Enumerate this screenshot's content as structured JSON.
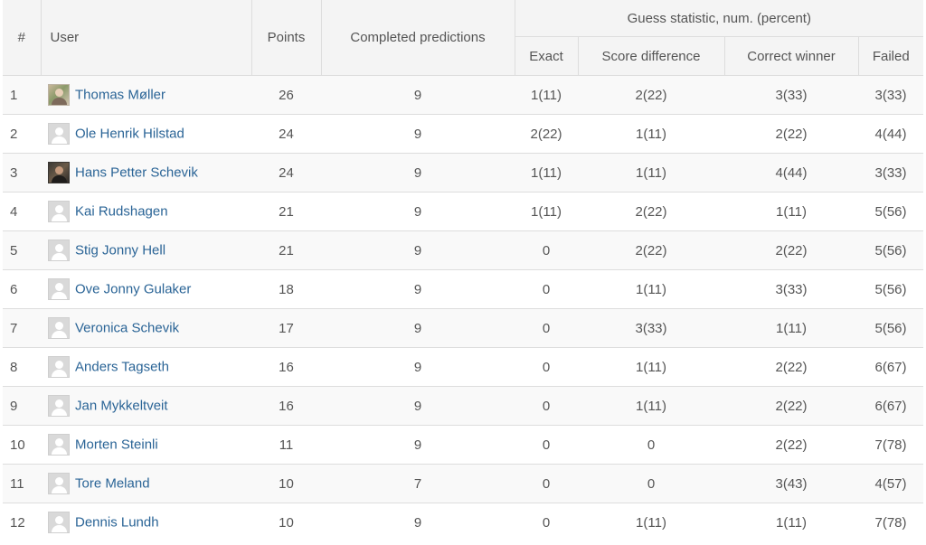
{
  "table": {
    "headers": {
      "num": "#",
      "user": "User",
      "points": "Points",
      "completed": "Completed predictions",
      "group": "Guess statistic, num. (percent)",
      "exact": "Exact",
      "score_diff": "Score difference",
      "correct_winner": "Correct winner",
      "failed": "Failed"
    },
    "rows": [
      {
        "rank": "1",
        "user": "Thomas Møller",
        "avatar": "photo1",
        "points": "26",
        "completed": "9",
        "exact": "1(11)",
        "score_diff": "2(22)",
        "correct_winner": "3(33)",
        "failed": "3(33)"
      },
      {
        "rank": "2",
        "user": "Ole Henrik Hilstad",
        "avatar": "default",
        "points": "24",
        "completed": "9",
        "exact": "2(22)",
        "score_diff": "1(11)",
        "correct_winner": "2(22)",
        "failed": "4(44)"
      },
      {
        "rank": "3",
        "user": "Hans Petter Schevik",
        "avatar": "photo2",
        "points": "24",
        "completed": "9",
        "exact": "1(11)",
        "score_diff": "1(11)",
        "correct_winner": "4(44)",
        "failed": "3(33)"
      },
      {
        "rank": "4",
        "user": "Kai Rudshagen",
        "avatar": "default",
        "points": "21",
        "completed": "9",
        "exact": "1(11)",
        "score_diff": "2(22)",
        "correct_winner": "1(11)",
        "failed": "5(56)"
      },
      {
        "rank": "5",
        "user": "Stig Jonny Hell",
        "avatar": "default",
        "points": "21",
        "completed": "9",
        "exact": "0",
        "score_diff": "2(22)",
        "correct_winner": "2(22)",
        "failed": "5(56)"
      },
      {
        "rank": "6",
        "user": "Ove Jonny Gulaker",
        "avatar": "default",
        "points": "18",
        "completed": "9",
        "exact": "0",
        "score_diff": "1(11)",
        "correct_winner": "3(33)",
        "failed": "5(56)"
      },
      {
        "rank": "7",
        "user": "Veronica Schevik",
        "avatar": "default",
        "points": "17",
        "completed": "9",
        "exact": "0",
        "score_diff": "3(33)",
        "correct_winner": "1(11)",
        "failed": "5(56)"
      },
      {
        "rank": "8",
        "user": "Anders Tagseth",
        "avatar": "default",
        "points": "16",
        "completed": "9",
        "exact": "0",
        "score_diff": "1(11)",
        "correct_winner": "2(22)",
        "failed": "6(67)"
      },
      {
        "rank": "9",
        "user": "Jan Mykkeltveit",
        "avatar": "default",
        "points": "16",
        "completed": "9",
        "exact": "0",
        "score_diff": "1(11)",
        "correct_winner": "2(22)",
        "failed": "6(67)"
      },
      {
        "rank": "10",
        "user": "Morten Steinli",
        "avatar": "default",
        "points": "11",
        "completed": "9",
        "exact": "0",
        "score_diff": "0",
        "correct_winner": "2(22)",
        "failed": "7(78)"
      },
      {
        "rank": "11",
        "user": "Tore Meland",
        "avatar": "default",
        "points": "10",
        "completed": "7",
        "exact": "0",
        "score_diff": "0",
        "correct_winner": "3(43)",
        "failed": "4(57)"
      },
      {
        "rank": "12",
        "user": "Dennis Lundh",
        "avatar": "default",
        "points": "10",
        "completed": "9",
        "exact": "0",
        "score_diff": "1(11)",
        "correct_winner": "1(11)",
        "failed": "7(78)"
      }
    ]
  },
  "colors": {
    "link": "#2a6496",
    "header_bg": "#f4f4f4",
    "stripe_bg": "#f9f9f9",
    "border": "#dddddd"
  }
}
